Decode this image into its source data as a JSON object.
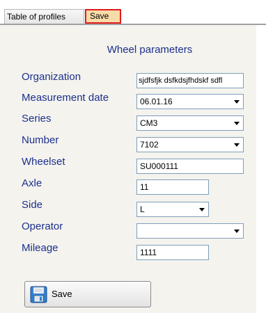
{
  "tabs": {
    "profiles_label": "Table of profiles",
    "save_label": "Save"
  },
  "form": {
    "title": "Wheel parameters",
    "organization": {
      "label": "Organization",
      "value": "sjdfsfjk dsfkdsjfhdskf sdfl"
    },
    "measurement_date": {
      "label": "Measurement date",
      "value": "06.01.16"
    },
    "series": {
      "label": "Series",
      "value": "CM3"
    },
    "number": {
      "label": "Number",
      "value": "7102"
    },
    "wheelset": {
      "label": "Wheelset",
      "value": "SU000111"
    },
    "axle": {
      "label": "Axle",
      "value": "11"
    },
    "side": {
      "label": "Side",
      "value": "L"
    },
    "operator": {
      "label": "Operator",
      "value": ""
    },
    "mileage": {
      "label": "Mileage",
      "value": "1111"
    }
  },
  "save_button": {
    "label": "Save",
    "icon": "floppy-disk-icon"
  },
  "colors": {
    "label_text": "#1c2f8c",
    "panel_background": "#f4f3ee",
    "active_tab_background": "#f7dba8",
    "active_tab_border": "#e01b1b",
    "field_border": "#7f9db9"
  }
}
